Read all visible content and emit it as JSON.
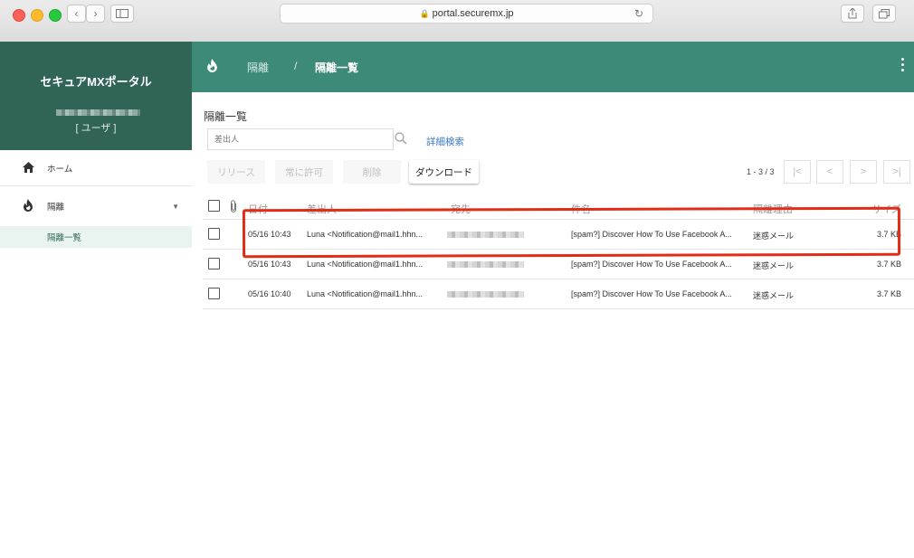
{
  "browser": {
    "url": "portal.securemx.jp"
  },
  "sidebar": {
    "app_title": "セキュアMXポータル",
    "user_role": "[ ユーザ ]",
    "items": [
      {
        "label": "ホーム",
        "icon": "home-icon"
      },
      {
        "label": "隔離",
        "icon": "fire-icon"
      },
      {
        "label": "隔離一覧"
      }
    ]
  },
  "header": {
    "breadcrumb": [
      "隔離",
      "/",
      "隔離一覧"
    ]
  },
  "main": {
    "title": "隔離一覧",
    "search_placeholder": "差出人",
    "advanced_search": "詳細検索",
    "buttons": {
      "release": "リリース",
      "always_allow": "常に許可",
      "delete": "削除",
      "download": "ダウンロード"
    },
    "pagination": {
      "count": "1 - 3 / 3",
      "first": "|<",
      "prev": "<",
      "next": ">",
      "last": ">|"
    },
    "columns": [
      "日付",
      "差出人",
      "宛先",
      "件名",
      "隔離理由",
      "サイズ"
    ],
    "rows": [
      {
        "date": "05/16 10:43",
        "from": "Luna <Notification@mail1.hhn...",
        "subject": "[spam?] Discover How To Use Facebook A...",
        "reason": "迷惑メール",
        "size": "3.7 KB"
      },
      {
        "date": "05/16 10:43",
        "from": "Luna <Notification@mail1.hhn...",
        "subject": "[spam?] Discover How To Use Facebook A...",
        "reason": "迷惑メール",
        "size": "3.7 KB"
      },
      {
        "date": "05/16 10:40",
        "from": "Luna <Notification@mail1.hhn...",
        "subject": "[spam?] Discover How To Use Facebook A...",
        "reason": "迷惑メール",
        "size": "3.7 KB"
      }
    ]
  },
  "colors": {
    "sidebar_header": "#2f6457",
    "topbar": "#3d8a79",
    "link": "#3a78c7",
    "highlight": "#e32c16"
  }
}
